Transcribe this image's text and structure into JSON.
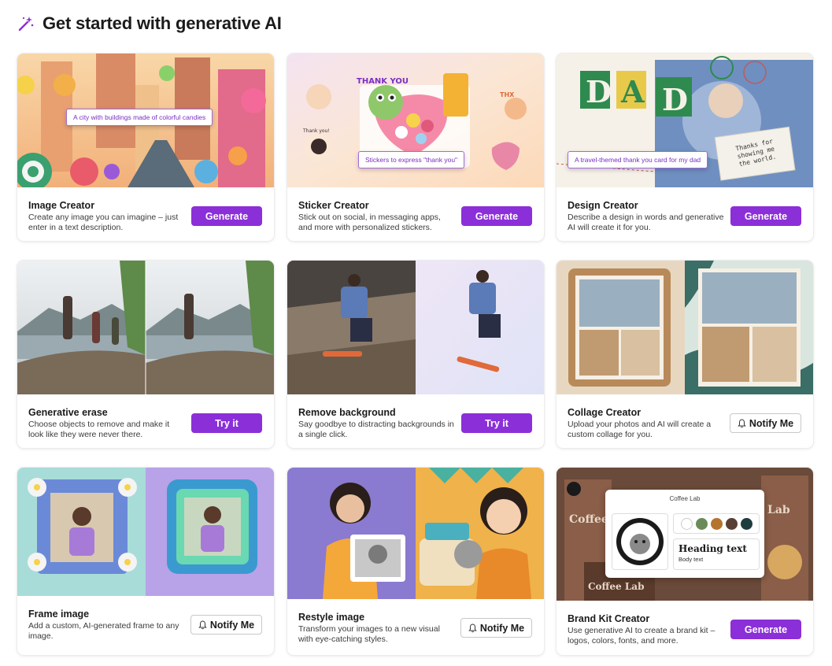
{
  "header": {
    "title": "Get started with generative AI",
    "icon": "magic-wand-icon"
  },
  "cards": [
    {
      "title": "Image Creator",
      "desc": "Create any image you can imagine – just enter in a text description.",
      "button": "Generate",
      "prompt": "A city with buildings made of colorful candies"
    },
    {
      "title": "Sticker Creator",
      "desc": "Stick out on social, in messaging apps, and more with personalized stickers.",
      "button": "Generate",
      "prompt": "Stickers to express \"thank you\"",
      "sticker_text": "THANK YOU",
      "small_labels": [
        "THX",
        "Thank you!"
      ]
    },
    {
      "title": "Design Creator",
      "desc": "Describe a design in words and generative AI will create it for you.",
      "button": "Generate",
      "prompt": "A travel-themed thank you card for my dad",
      "big_text": [
        "D",
        "A",
        "D"
      ],
      "note": "Thanks for showing me the world."
    },
    {
      "title": "Generative erase",
      "desc": "Choose objects to remove and make it look like they were never there.",
      "button": "Try it"
    },
    {
      "title": "Remove background",
      "desc": "Say goodbye to distracting backgrounds in a single click.",
      "button": "Try it"
    },
    {
      "title": "Collage Creator",
      "desc": "Upload your photos and AI will create a custom collage for you.",
      "button": "Notify Me"
    },
    {
      "title": "Frame image",
      "desc": "Add a custom, AI-generated frame to any image.",
      "button": "Notify Me"
    },
    {
      "title": "Restyle image",
      "desc": "Transform your images to a new visual with eye-catching styles.",
      "button": "Notify Me"
    },
    {
      "title": "Brand Kit Creator",
      "desc": "Use generative AI to create a brand kit – logos, colors, fonts, and more.",
      "button": "Generate",
      "brand": {
        "name": "Coffee Lab",
        "heading": "Heading text",
        "body": "Body text",
        "bg_title": "Coffee Lab",
        "bg_sub": "Lab"
      },
      "swatches": [
        "#ffffff",
        "#6b8a5a",
        "#b5742e",
        "#5a3f34",
        "#1f3d3f"
      ]
    }
  ],
  "colors": {
    "accent": "#8b2fd8",
    "prompt": "#7a2fc6"
  }
}
